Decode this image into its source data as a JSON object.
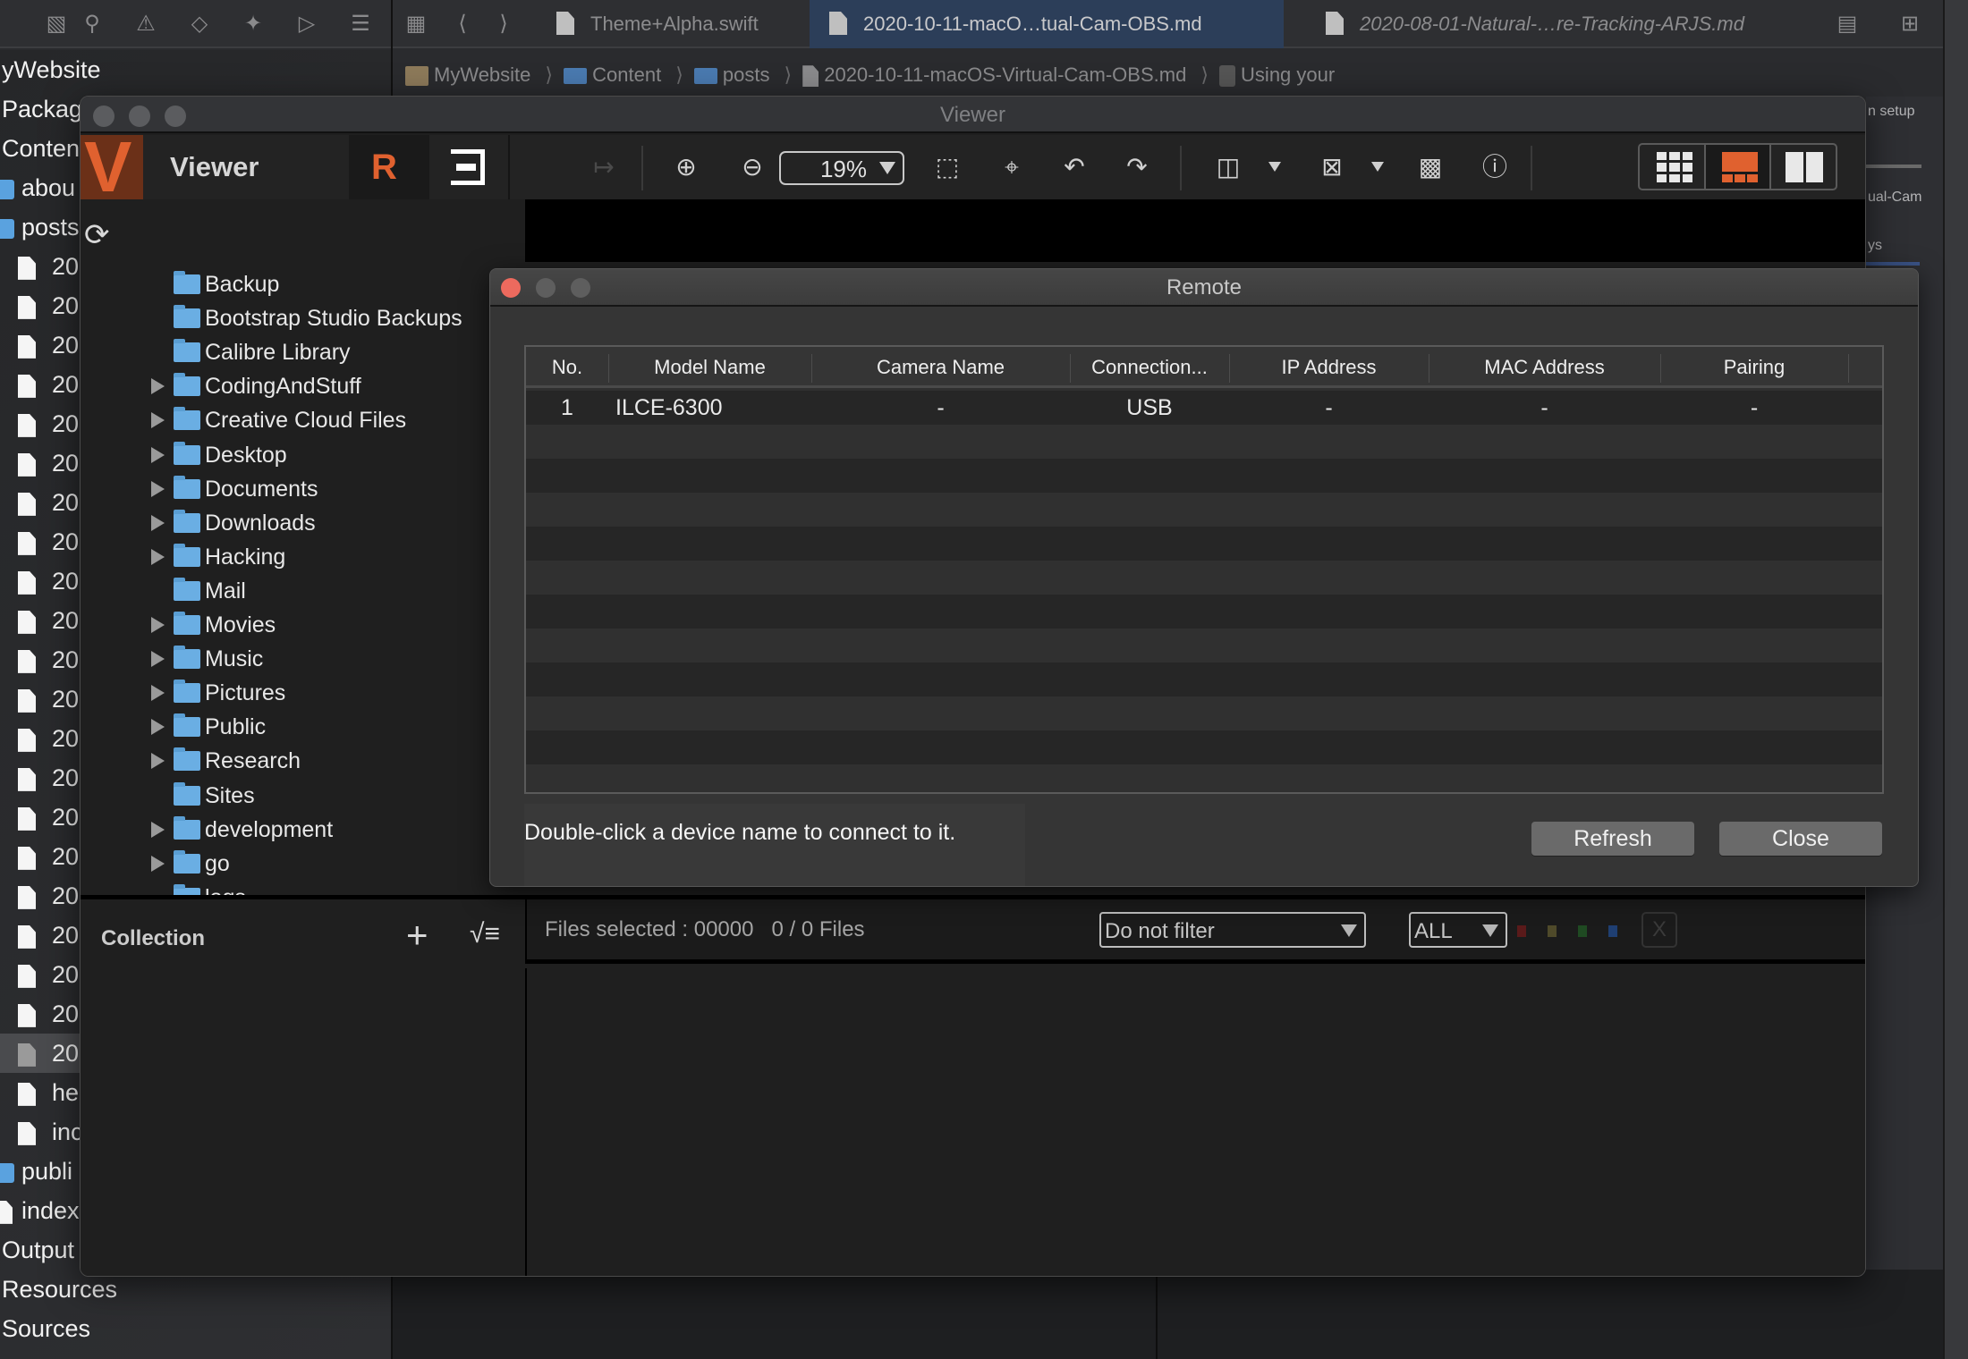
{
  "xcode": {
    "nav_icons": [
      "hierarchy-icon",
      "search-icon",
      "warning-icon",
      "breakpoint-icon",
      "debug-spray-icon",
      "tag-icon",
      "report-list-icon"
    ],
    "tabs": [
      {
        "label": "Theme+Alpha.swift",
        "active": false,
        "italic": false
      },
      {
        "label": "2020-10-11-macO…tual-Cam-OBS.md",
        "active": true,
        "italic": false
      },
      {
        "label": "2020-08-01-Natural-…re-Tracking-ARJS.md",
        "active": false,
        "italic": true
      }
    ],
    "breadcrumb": [
      "MyWebsite",
      "Content",
      "posts",
      "2020-10-11-macOS-Virtual-Cam-OBS.md",
      "Using your"
    ],
    "sidebar": [
      {
        "label": "yWebsite",
        "kind": "title"
      },
      {
        "label": "Packag",
        "kind": "group"
      },
      {
        "label": "Conten",
        "kind": "group"
      },
      {
        "label": "abou",
        "kind": "folder"
      },
      {
        "label": "posts",
        "kind": "folder"
      },
      {
        "label": "20",
        "kind": "file"
      },
      {
        "label": "20",
        "kind": "file"
      },
      {
        "label": "20",
        "kind": "file"
      },
      {
        "label": "20",
        "kind": "file"
      },
      {
        "label": "20",
        "kind": "file"
      },
      {
        "label": "20",
        "kind": "file"
      },
      {
        "label": "20",
        "kind": "file"
      },
      {
        "label": "20",
        "kind": "file"
      },
      {
        "label": "20",
        "kind": "file"
      },
      {
        "label": "20",
        "kind": "file"
      },
      {
        "label": "20",
        "kind": "file"
      },
      {
        "label": "20",
        "kind": "file"
      },
      {
        "label": "20",
        "kind": "file"
      },
      {
        "label": "20",
        "kind": "file"
      },
      {
        "label": "20",
        "kind": "file"
      },
      {
        "label": "20",
        "kind": "file"
      },
      {
        "label": "20",
        "kind": "file"
      },
      {
        "label": "20",
        "kind": "file"
      },
      {
        "label": "20",
        "kind": "file"
      },
      {
        "label": "20",
        "kind": "file"
      },
      {
        "label": "20",
        "kind": "file",
        "selected": true
      },
      {
        "label": "he",
        "kind": "file"
      },
      {
        "label": "inc",
        "kind": "file"
      },
      {
        "label": "publi",
        "kind": "folder"
      },
      {
        "label": "index",
        "kind": "rootfile"
      },
      {
        "label": "Output",
        "kind": "group"
      },
      {
        "label": "Resources",
        "kind": "group"
      },
      {
        "label": "Sources",
        "kind": "group"
      }
    ],
    "right_panel_fragments": [
      "n setup",
      "ual-Cam",
      "ys"
    ]
  },
  "viewer": {
    "window_title": "Viewer",
    "app_name": "Viewer",
    "zoom_level": "19%",
    "toolbar_icons": [
      "export-icon",
      "zoom-in-icon",
      "zoom-out-icon",
      "fit-screen-icon",
      "actual-size-icon",
      "rotate-left-icon",
      "rotate-right-icon",
      "grid-overlay-icon",
      "guide-overlay-icon",
      "histogram-icon",
      "info-icon"
    ],
    "layout_modes": [
      {
        "name": "grid-view",
        "active": false
      },
      {
        "name": "preview-with-filmstrip",
        "active": true
      },
      {
        "name": "compare-view",
        "active": false
      }
    ],
    "accent_color": "#e0612f",
    "folders": [
      {
        "label": "Backup",
        "expandable": false
      },
      {
        "label": "Bootstrap Studio Backups",
        "expandable": false
      },
      {
        "label": "Calibre Library",
        "expandable": false
      },
      {
        "label": "CodingAndStuff",
        "expandable": true
      },
      {
        "label": "Creative Cloud Files",
        "expandable": true
      },
      {
        "label": "Desktop",
        "expandable": true
      },
      {
        "label": "Documents",
        "expandable": true
      },
      {
        "label": "Downloads",
        "expandable": true
      },
      {
        "label": "Hacking",
        "expandable": true
      },
      {
        "label": "Mail",
        "expandable": false
      },
      {
        "label": "Movies",
        "expandable": true
      },
      {
        "label": "Music",
        "expandable": true
      },
      {
        "label": "Pictures",
        "expandable": true
      },
      {
        "label": "Public",
        "expandable": true
      },
      {
        "label": "Research",
        "expandable": true
      },
      {
        "label": "Sites",
        "expandable": false
      },
      {
        "label": "development",
        "expandable": true
      },
      {
        "label": "go",
        "expandable": true
      },
      {
        "label": "logs",
        "expandable": false
      }
    ],
    "collection": {
      "title": "Collection",
      "add_icon": "+",
      "sort_icon": "√≡"
    },
    "status": {
      "files_selected": "Files selected : 00000",
      "file_count": "0 / 0 Files",
      "filter_value": "Do not filter",
      "rating_value": "ALL",
      "color_labels": [
        "#5a1a1a",
        "#4f4a2a",
        "#1f4a22",
        "#1f3f72"
      ],
      "clear_label": "X"
    }
  },
  "remote": {
    "title": "Remote",
    "columns": [
      "No.",
      "Model Name",
      "Camera Name",
      "Connection...",
      "IP Address",
      "MAC Address",
      "Pairing"
    ],
    "rows": [
      [
        "1",
        "ILCE-6300",
        "-",
        "USB",
        "-",
        "-",
        "-"
      ]
    ],
    "empty_rows": 10,
    "hint": "Double-click a device name to connect to it.",
    "buttons": {
      "refresh": "Refresh",
      "close": "Close"
    }
  }
}
